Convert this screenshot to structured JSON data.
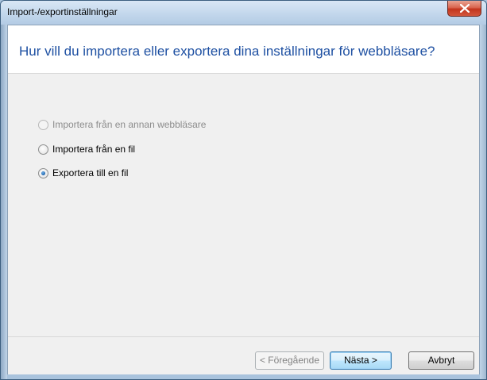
{
  "window": {
    "title": "Import-/exportinställningar",
    "close_icon": "close-x-icon"
  },
  "header": {
    "question": "Hur vill du importera eller exportera dina inställningar för webbläsare?"
  },
  "options": [
    {
      "label": "Importera från en annan webbläsare",
      "enabled": false,
      "selected": false
    },
    {
      "label": "Importera från en fil",
      "enabled": true,
      "selected": false
    },
    {
      "label": "Exportera till en fil",
      "enabled": true,
      "selected": true
    }
  ],
  "buttons": {
    "back": "< Föregående",
    "next": "Nästa >",
    "cancel": "Avbryt"
  },
  "colors": {
    "accent_title": "#1e50a2",
    "close_button": "#c2351d"
  }
}
